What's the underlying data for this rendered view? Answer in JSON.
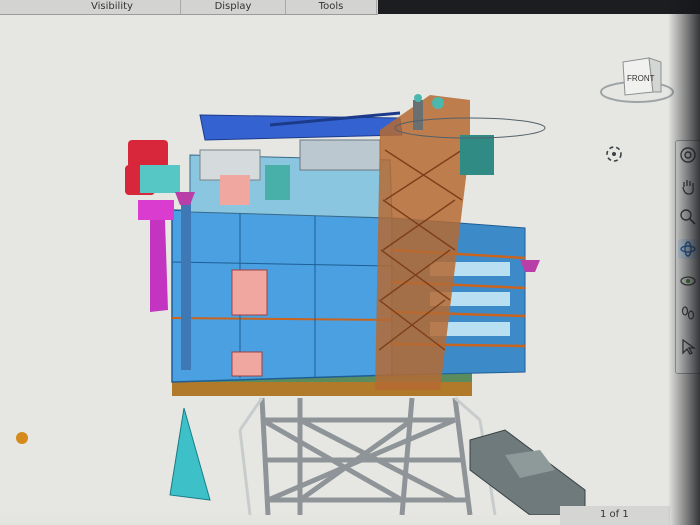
{
  "menu": {
    "tabs": [
      "Visibility",
      "Display",
      "Tools"
    ]
  },
  "viewcube": {
    "face_label": "FRONT"
  },
  "navbar": {
    "buttons": [
      {
        "icon": "steering-wheel-icon"
      },
      {
        "icon": "pan-hand-icon"
      },
      {
        "icon": "zoom-window-icon"
      },
      {
        "icon": "orbit-icon"
      },
      {
        "icon": "look-icon"
      },
      {
        "icon": "walk-icon"
      },
      {
        "icon": "select-arrow-icon"
      }
    ]
  },
  "status": {
    "page": "1 of 1"
  },
  "colors": {
    "accent": "#3b82c4",
    "structure": "#c9641e",
    "deck": "#4aa0e0"
  }
}
